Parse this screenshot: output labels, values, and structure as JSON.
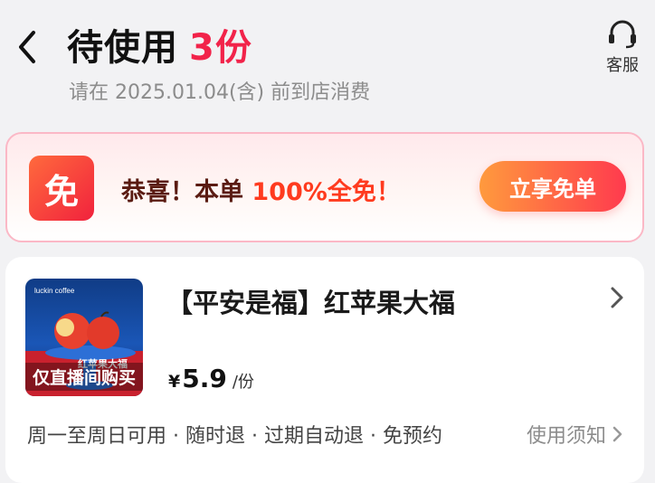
{
  "header": {
    "title": "待使用",
    "count": "3份",
    "subtitle": "请在 2025.01.04(含) 前到店消费",
    "service_label": "客服"
  },
  "promo": {
    "badge_label": "免",
    "text_prefix": "恭喜！本单 ",
    "text_highlight": "100%全免！",
    "button_label": "立享免单"
  },
  "product": {
    "title": "【平安是福】红苹果大福",
    "thumbnail_brand": "luckin coffee",
    "thumbnail_caption": "红苹果大福",
    "thumbnail_overlay": "仅直播间购买",
    "price_symbol": "¥",
    "price": "5.9",
    "price_unit": "/份",
    "features": "周一至周日可用 · 随时退 · 过期自动退 · 免预约",
    "notice_label": "使用须知"
  },
  "colors": {
    "accent_red": "#f2234a",
    "promo_orange": "#ff3b1f",
    "button_gradient_start": "#ff9a3d",
    "button_gradient_end": "#ff3a4e"
  },
  "icons": {
    "back": "chevron-left-icon",
    "service": "headset-icon",
    "card_arrow": "chevron-right-icon",
    "notice_arrow": "chevron-right-icon"
  }
}
